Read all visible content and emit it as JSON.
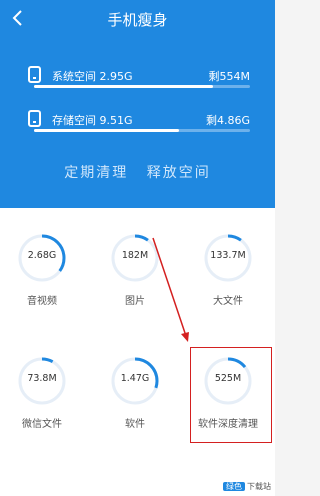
{
  "header": {
    "title": "手机瘦身"
  },
  "storage": [
    {
      "label": "系统空间 2.95G",
      "free": "剩554M",
      "used_fraction": 0.83
    },
    {
      "label": "存储空间 9.51G",
      "free": "剩4.86G",
      "used_fraction": 0.67
    }
  ],
  "actions": {
    "clean": "定期清理",
    "release": "释放空间"
  },
  "categories": [
    {
      "value": "2.68G",
      "label": "音视频",
      "fraction": 0.35
    },
    {
      "value": "182M",
      "label": "图片",
      "fraction": 0.1
    },
    {
      "value": "133.7M",
      "label": "大文件",
      "fraction": 0.1
    },
    {
      "value": "73.8M",
      "label": "微信文件",
      "fraction": 0.08
    },
    {
      "value": "1.47G",
      "label": "软件",
      "fraction": 0.3
    },
    {
      "value": "525M",
      "label": "软件深度清理",
      "fraction": 0.14
    }
  ],
  "watermark": {
    "badge": "绿色",
    "text": "下载站"
  },
  "colors": {
    "accent": "#1f88e0",
    "ring_track": "#e6eef7",
    "highlight": "#d42020"
  }
}
